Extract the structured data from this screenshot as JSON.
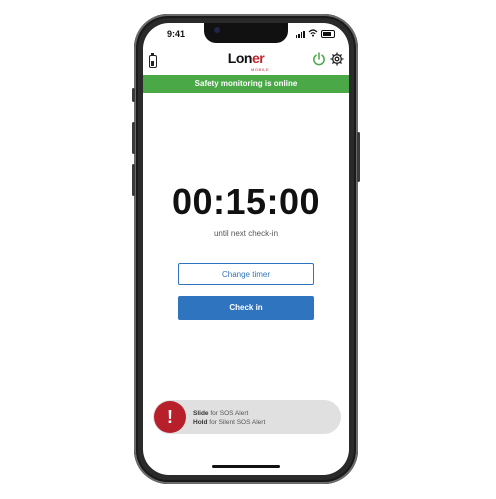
{
  "status_bar": {
    "time": "9:41"
  },
  "app": {
    "logo_main_a": "Lon",
    "logo_main_b": "er",
    "logo_sub": "MOBILE",
    "banner": "Safety monitoring is online"
  },
  "timer": {
    "value": "00:15:00",
    "caption": "until next check-in"
  },
  "buttons": {
    "change_timer": "Change timer",
    "check_in": "Check in"
  },
  "sos": {
    "knob_symbol": "!",
    "slide_word": "Slide",
    "slide_rest": " for SOS Alert",
    "hold_word": "Hold",
    "hold_rest": " for Silent SOS Alert"
  },
  "colors": {
    "banner_green": "#4aa847",
    "primary_blue": "#2f74bf",
    "sos_red": "#b71f2b",
    "brand_red": "#c0272d",
    "power_green": "#4aa847"
  },
  "icons": [
    "phone-battery-icon",
    "power-icon",
    "gear-icon",
    "signal-icon",
    "wifi-icon",
    "battery-icon",
    "exclamation-icon"
  ]
}
